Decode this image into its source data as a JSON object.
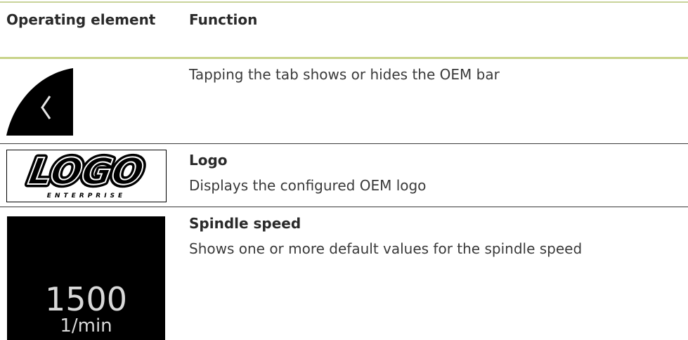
{
  "table": {
    "headers": {
      "operating_element": "Operating element",
      "function": "Function"
    },
    "rows": [
      {
        "element_icon": "oem-bar-tab-icon",
        "title": "",
        "description": "Tapping the tab shows or hides the OEM bar"
      },
      {
        "element_icon": "oem-logo-image",
        "title": "Logo",
        "description": "Displays the configured OEM logo",
        "logo_text": "LOGO",
        "logo_subtext": "ENTERPRISE"
      },
      {
        "element_icon": "spindle-speed-display",
        "title": "Spindle speed",
        "description": "Shows one or more default values for the spindle speed",
        "spindle_value": "1500",
        "spindle_unit": "1/min"
      }
    ]
  },
  "colors": {
    "header_rule": "#c8d389",
    "row_rule": "#3a3a3a",
    "text": "#2a2a2a",
    "icon_bg": "#000000",
    "icon_fg": "#d9d9d9"
  }
}
